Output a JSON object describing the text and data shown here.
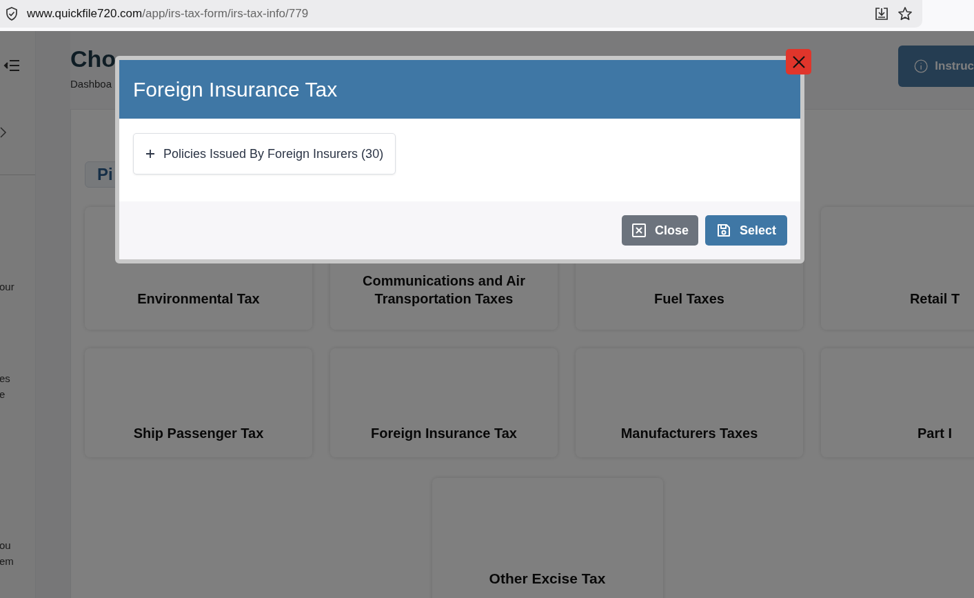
{
  "browser": {
    "url_host": "www.quickfile720.com",
    "url_path": "/app/irs-tax-form/irs-tax-info/779"
  },
  "page": {
    "title": "Cho",
    "breadcrumb": "Dashboa",
    "instructions_button": "Instruc",
    "filter_pill": "Pi",
    "sidebar_fragments": [
      [
        "our"
      ],
      [
        "es",
        "e"
      ],
      [
        "ou",
        "em"
      ]
    ],
    "categories": [
      {
        "label": "Environmental Tax"
      },
      {
        "label": "Communications and Air Transportation Taxes"
      },
      {
        "label": "Fuel Taxes"
      },
      {
        "label": "Retail T"
      },
      {
        "label": "Ship Passenger Tax"
      },
      {
        "label": "Foreign Insurance Tax"
      },
      {
        "label": "Manufacturers Taxes"
      },
      {
        "label": "Part I"
      },
      {
        "label": "Other Excise Tax"
      }
    ]
  },
  "modal": {
    "title": "Foreign Insurance Tax",
    "items": [
      {
        "label": "Policies Issued By Foreign Insurers (30)",
        "expanded": false
      }
    ],
    "buttons": [
      {
        "kind": "close",
        "label": "Close"
      },
      {
        "kind": "select",
        "label": "Select"
      }
    ]
  }
}
